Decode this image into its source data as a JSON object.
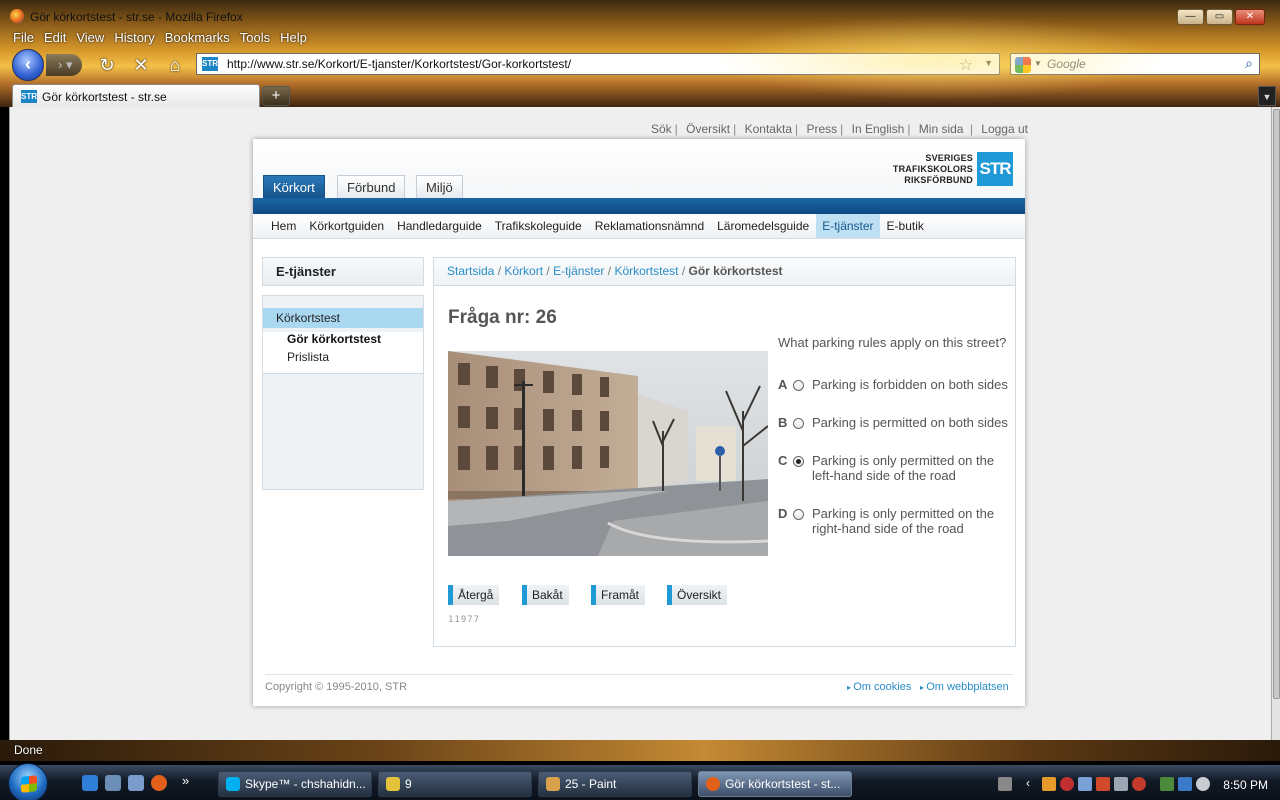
{
  "window": {
    "title": "Gör körkortstest - str.se - Mozilla Firefox"
  },
  "menubar": [
    "File",
    "Edit",
    "View",
    "History",
    "Bookmarks",
    "Tools",
    "Help"
  ],
  "navbar": {
    "url": "http://www.str.se/Korkort/E-tjanster/Korkortstest/Gor-korkortstest/",
    "search_placeholder": "Google"
  },
  "tabs": [
    {
      "label": "Gör körkortstest - str.se"
    }
  ],
  "site": {
    "top_links": [
      "Sök",
      "Översikt",
      "Kontakta",
      "Press",
      "In English",
      "Min sida",
      "Logga ut"
    ],
    "logo": {
      "line1": "SVERIGES",
      "line2": "TRAFIKSKOLORS",
      "line3": "RIKSFÖRBUND",
      "box": "STR"
    },
    "main_tabs": [
      "Körkort",
      "Förbund",
      "Miljö"
    ],
    "subnav": [
      "Hem",
      "Körkortguiden",
      "Handledarguide",
      "Trafikskoleguide",
      "Reklamationsnämnd",
      "Läromedelsguide",
      "E-tjänster",
      "E-butik"
    ],
    "subnav_active": "E-tjänster",
    "sidebar": {
      "heading": "E-tjänster",
      "active_item": "Körkortstest",
      "sub_items": [
        "Gör körkortstest",
        "Prislista"
      ]
    },
    "breadcrumb": [
      "Startsida",
      "Körkort",
      "E-tjänster",
      "Körkortstest"
    ],
    "breadcrumb_current": "Gör körkortstest",
    "question": {
      "title": "Fråga nr: 26",
      "text": "What parking rules apply on this street?",
      "options": [
        {
          "letter": "A",
          "text": "Parking is forbidden on both sides",
          "selected": false
        },
        {
          "letter": "B",
          "text": "Parking is permitted on both sides",
          "selected": false
        },
        {
          "letter": "C",
          "text": "Parking is only permitted on the left-hand side of the road",
          "selected": true
        },
        {
          "letter": "D",
          "text": "Parking is only permitted on the right-hand side of the road",
          "selected": false
        }
      ],
      "id_code": "11977"
    },
    "buttons": [
      "Återgå",
      "Bakåt",
      "Framåt",
      "Översikt"
    ],
    "footer": {
      "copyright": "Copyright © 1995-2010, STR",
      "links": [
        "Om cookies",
        "Om webbplatsen"
      ]
    }
  },
  "statusbar": {
    "text": "Done"
  },
  "taskbar": {
    "items": [
      {
        "label": "Skype™ - chshahidn...",
        "color": "#00aff0"
      },
      {
        "label": "9",
        "color": "#e3c33a"
      },
      {
        "label": "25 - Paint",
        "color": "#d9a24a"
      },
      {
        "label": "Gör körkortstest - st...",
        "color": "#e2601a"
      }
    ],
    "clock": "8:50 PM"
  },
  "colors": {
    "accent": "#1f9ad6",
    "link": "#2a8cc6",
    "nav_blue": "#15548c"
  }
}
